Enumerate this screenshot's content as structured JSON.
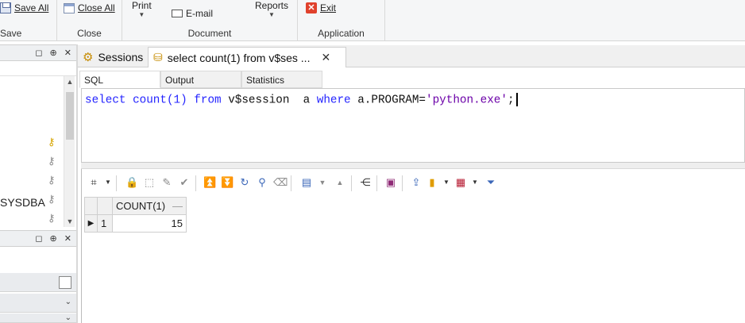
{
  "ribbon": {
    "save_group": {
      "save_all": "Save All",
      "label": "Save"
    },
    "close_group": {
      "close_all": "Close All",
      "label": "Close"
    },
    "document_group": {
      "print": "Print",
      "email": "E-mail",
      "label": "Document"
    },
    "application_group": {
      "reports": "Reports",
      "exit": "Exit",
      "label": "Application"
    }
  },
  "left_panel": {
    "pin_buttons": "◻ ⊕ ✕",
    "tree_partial_item": "SYSDBA"
  },
  "tabs": [
    {
      "label": "Sessions",
      "icon": "sessions-icon"
    },
    {
      "label": "select count(1) from v$ses ...",
      "icon": "sql-icon",
      "active": true
    }
  ],
  "subtabs": [
    "SQL",
    "Output",
    "Statistics"
  ],
  "editor": {
    "kw1": "select",
    "fn": " count(1) ",
    "kw2": "from",
    "table": " v$session  a ",
    "kw3": "where",
    "cond": " a.PROGRAM=",
    "str": "'python.exe'",
    "end": ";"
  },
  "grid": {
    "columns": [
      "COUNT(1)"
    ],
    "rows": [
      {
        "num": "1",
        "values": [
          "15"
        ]
      }
    ]
  },
  "colors": {
    "keyword": "#2424ff",
    "string": "#6b00a8",
    "exit_red": "#e0412c"
  }
}
